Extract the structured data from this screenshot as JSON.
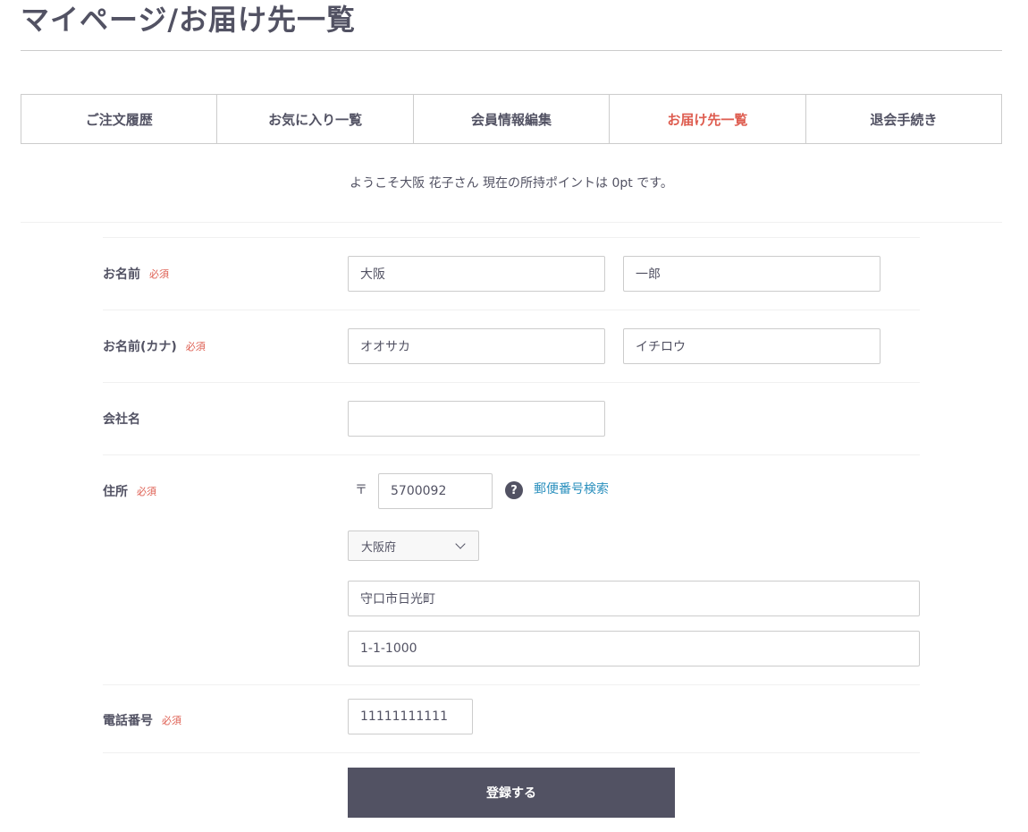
{
  "page": {
    "title": "マイページ/お届け先一覧"
  },
  "tabs": [
    {
      "label": "ご注文履歴",
      "active": false
    },
    {
      "label": "お気に入り一覧",
      "active": false
    },
    {
      "label": "会員情報編集",
      "active": false
    },
    {
      "label": "お届け先一覧",
      "active": true
    },
    {
      "label": "退会手続き",
      "active": false
    }
  ],
  "welcome": "ようこそ大阪 花子さん 現在の所持ポイントは 0pt です。",
  "required_label": "必須",
  "form": {
    "name": {
      "label": "お名前",
      "last": "大阪",
      "first": "一郎"
    },
    "kana": {
      "label": "お名前(カナ)",
      "last": "オオサカ",
      "first": "イチロウ"
    },
    "company": {
      "label": "会社名",
      "value": ""
    },
    "address": {
      "label": "住所",
      "zip_mark": "〒",
      "zip": "5700092",
      "zip_search_link": "郵便番号検索",
      "prefecture": "大阪府",
      "city": "守口市日光町",
      "street": "1-1-1000"
    },
    "phone": {
      "label": "電話番号",
      "value": "11111111111"
    }
  },
  "submit_label": "登録する",
  "colors": {
    "text": "#525263",
    "accent": "#de5d50",
    "link": "#2a8fbd",
    "button": "#525263"
  },
  "icons": {
    "help": "question-circle-icon",
    "dropdown": "chevron-down-icon"
  }
}
